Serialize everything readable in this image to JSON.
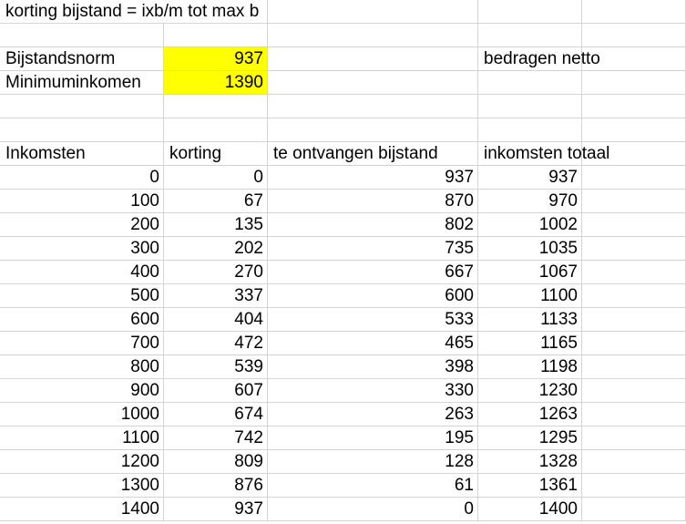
{
  "title": "korting bijstand = ixb/m tot max b",
  "labels": {
    "bijstandsnorm": "Bijstandsnorm",
    "minimuminkomen": "Minimuminkomen",
    "bedragen_netto": "bedragen netto"
  },
  "values": {
    "bijstandsnorm": "937",
    "minimuminkomen": "1390"
  },
  "highlight_color": "#ffff00",
  "headers": [
    "Inkomsten",
    "korting",
    "te ontvangen bijstand",
    "inkomsten totaal"
  ],
  "rows": [
    [
      "0",
      "0",
      "937",
      "937"
    ],
    [
      "100",
      "67",
      "870",
      "970"
    ],
    [
      "200",
      "135",
      "802",
      "1002"
    ],
    [
      "300",
      "202",
      "735",
      "1035"
    ],
    [
      "400",
      "270",
      "667",
      "1067"
    ],
    [
      "500",
      "337",
      "600",
      "1100"
    ],
    [
      "600",
      "404",
      "533",
      "1133"
    ],
    [
      "700",
      "472",
      "465",
      "1165"
    ],
    [
      "800",
      "539",
      "398",
      "1198"
    ],
    [
      "900",
      "607",
      "330",
      "1230"
    ],
    [
      "1000",
      "674",
      "263",
      "1263"
    ],
    [
      "1100",
      "742",
      "195",
      "1295"
    ],
    [
      "1200",
      "809",
      "128",
      "1328"
    ],
    [
      "1300",
      "876",
      "61",
      "1361"
    ],
    [
      "1400",
      "937",
      "0",
      "1400"
    ]
  ]
}
